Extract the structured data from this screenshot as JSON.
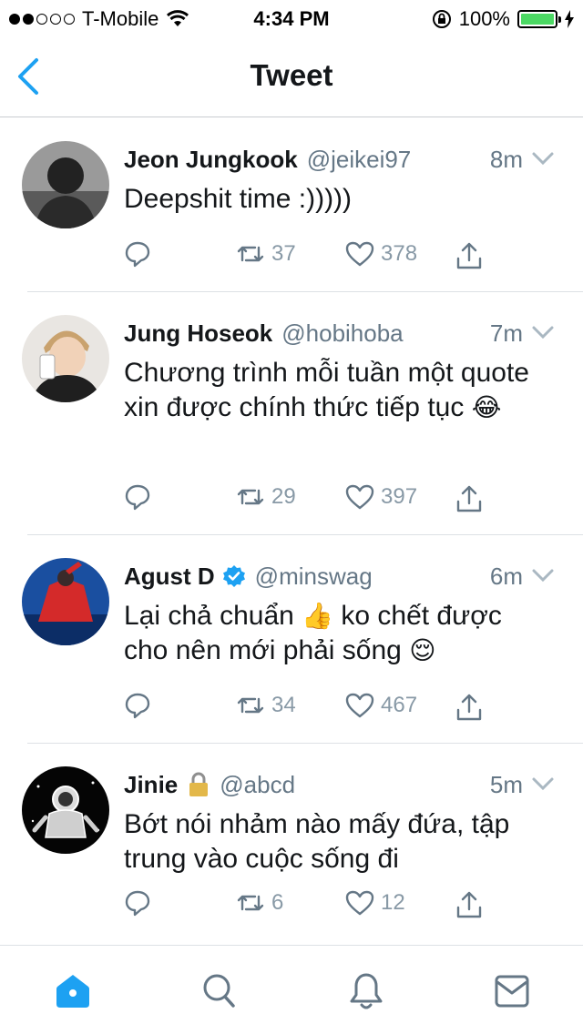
{
  "status_bar": {
    "carrier": "T-Mobile",
    "time": "4:34 PM",
    "battery_percent": "100%",
    "signal_bars_filled": 2,
    "signal_bars_total": 5,
    "battery_level": 1.0
  },
  "nav": {
    "title": "Tweet",
    "back_icon": "chevron-left-icon"
  },
  "colors": {
    "accent": "#1da1f2",
    "secondary_text": "#657786",
    "icon_gray": "#8899a6",
    "divider": "#dde1e5"
  },
  "tweets": [
    {
      "name": "Jeon Jungkook",
      "handle": "@jeikei97",
      "time": "8m",
      "text": "Deepshit time :)))))",
      "emoji": "",
      "verified": false,
      "protected": false,
      "retweets": "37",
      "likes": "378"
    },
    {
      "name": "Jung Hoseok",
      "handle": "@hobihoba",
      "time": "7m",
      "text": "Chương trình mỗi tuần một quote xin được chính thức tiếp tục",
      "emoji": "😂",
      "verified": false,
      "protected": false,
      "retweets": "29",
      "likes": "397"
    },
    {
      "name": "Agust D",
      "handle": "@minswag",
      "time": "6m",
      "text_part1": "Lại chả chuẩn",
      "emoji1": "👍",
      "text_part2": "ko chết được cho nên mới phải sống",
      "emoji2": "😌",
      "verified": true,
      "protected": false,
      "retweets": "34",
      "likes": "467"
    },
    {
      "name": "Jinie",
      "handle": "@abcd",
      "time": "5m",
      "text": "Bớt nói nhảm nào mấy đứa, tập trung vào cuộc sống đi",
      "emoji": "",
      "verified": false,
      "protected": true,
      "retweets": "6",
      "likes": "12"
    }
  ],
  "tab_bar": {
    "items": [
      "home-icon",
      "search-icon",
      "notifications-icon",
      "messages-icon"
    ],
    "active": "home-icon"
  }
}
